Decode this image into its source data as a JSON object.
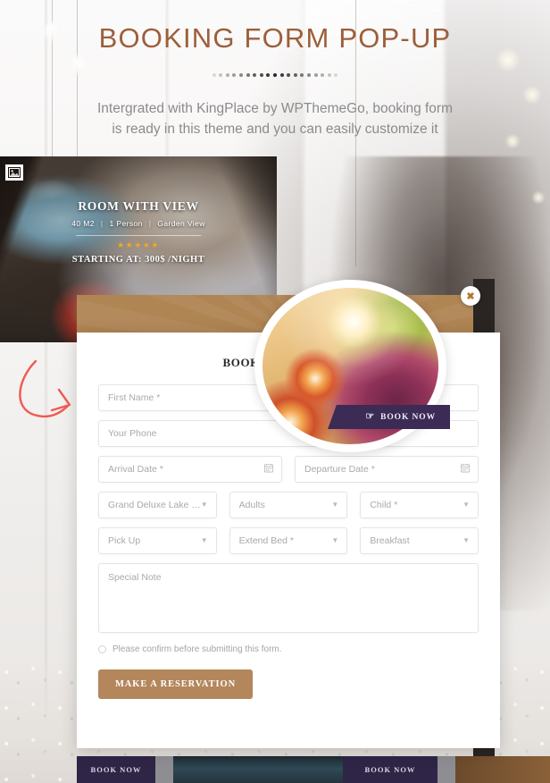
{
  "section": {
    "title": "BOOKING FORM POP-UP",
    "subtitle_line1": "Intergrated with KingPlace by WPThemeGo, booking form",
    "subtitle_line2": "is ready in this theme and you can easily customize it",
    "title_color": "#9c5f3a",
    "dots_count": 19
  },
  "room_card": {
    "image_badge_icon": "image-placeholder-icon",
    "name": "ROOM WITH VIEW",
    "meta": [
      "40 M2",
      "1 Person",
      "Garden View"
    ],
    "meta_separator": "|",
    "stars": "★★★★★",
    "stars_count": 5,
    "price": "STARTING AT: 300$ /NIGHT",
    "book_now": "BOOK NOW"
  },
  "modal": {
    "close_icon": "close-icon",
    "close_label": "✖",
    "form_title": "BOOKING FORM - GR",
    "fields": {
      "first_name": "First Name *",
      "your_phone": "Your Phone",
      "arrival_date": "Arrival Date *",
      "departure_date": "Departure Date *",
      "room_type": "Grand Deluxe Lake View",
      "adults": "Adults",
      "child": "Child *",
      "pick_up": "Pick Up",
      "extend_bed": "Extend Bed *",
      "breakfast": "Breakfast",
      "special_note": "Special Note"
    },
    "calendar_icon": "calendar-icon",
    "caret_icon": "chevron-down-icon",
    "confirm_text": "Please confirm before submitting this form.",
    "submit_label": "MAKE A RESERVATION",
    "submit_color": "#b3865c"
  },
  "circle_promo": {
    "cta_label": "BOOK NOW",
    "cursor_icon": "hand-pointer-icon",
    "cta_color": "#3b2b55"
  },
  "bottom_bars": {
    "left_label": "BOOK NOW",
    "right_label": "BOOK NOW",
    "bar_color": "#2f2547"
  },
  "annotation": {
    "arrow_icon": "curved-arrow-icon",
    "arrow_color": "#ef5a52"
  }
}
